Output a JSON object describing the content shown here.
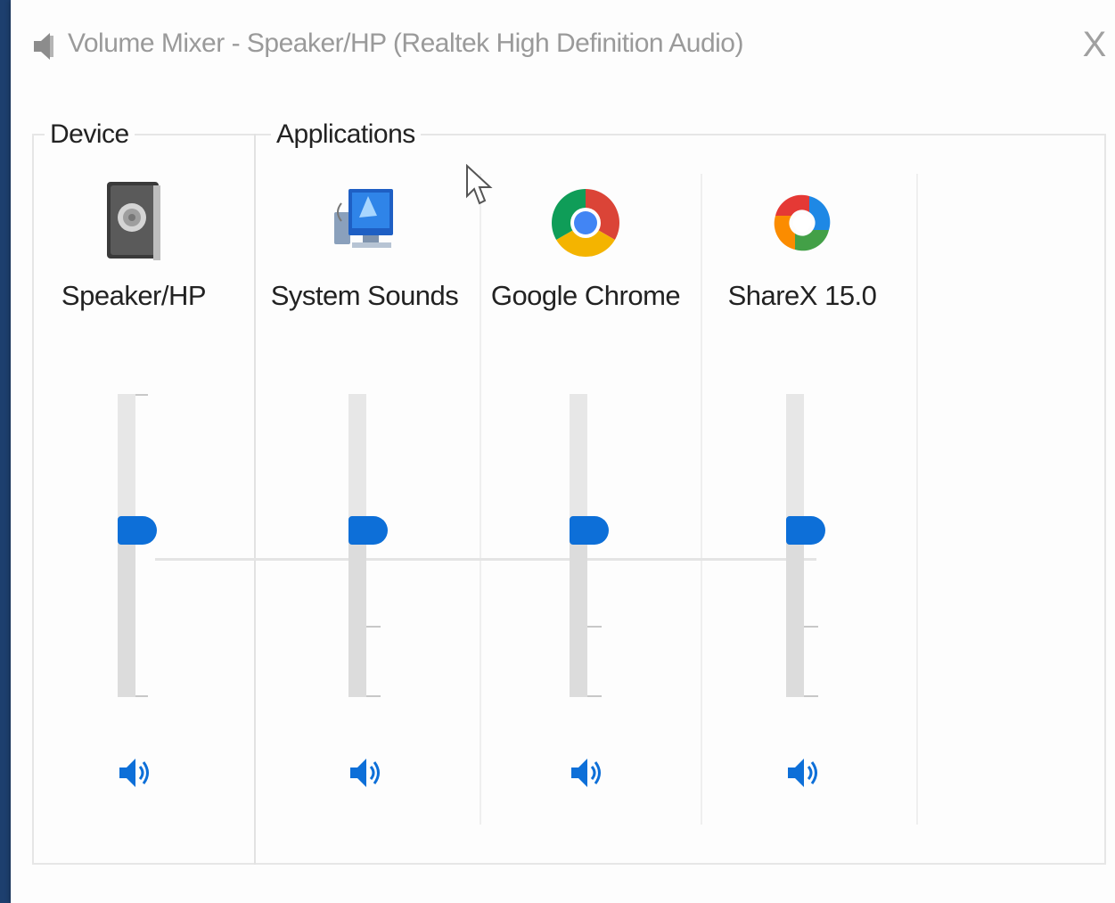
{
  "window": {
    "title": "Volume Mixer - Speaker/HP (Realtek High Definition Audio)",
    "close_label": "X"
  },
  "groups": {
    "device_label": "Device",
    "applications_label": "Applications"
  },
  "channels": [
    {
      "name": "Speaker/HP",
      "icon": "speaker-device-icon",
      "volume_percent": 55
    },
    {
      "name": "System Sounds",
      "icon": "system-sounds-icon",
      "volume_percent": 55
    },
    {
      "name": "Google Chrome",
      "icon": "google-chrome-icon",
      "volume_percent": 55
    },
    {
      "name": "ShareX 15.0",
      "icon": "sharex-icon",
      "volume_percent": 55
    }
  ],
  "colors": {
    "accent": "#0d6fd8",
    "track": "#e7e7e7"
  }
}
